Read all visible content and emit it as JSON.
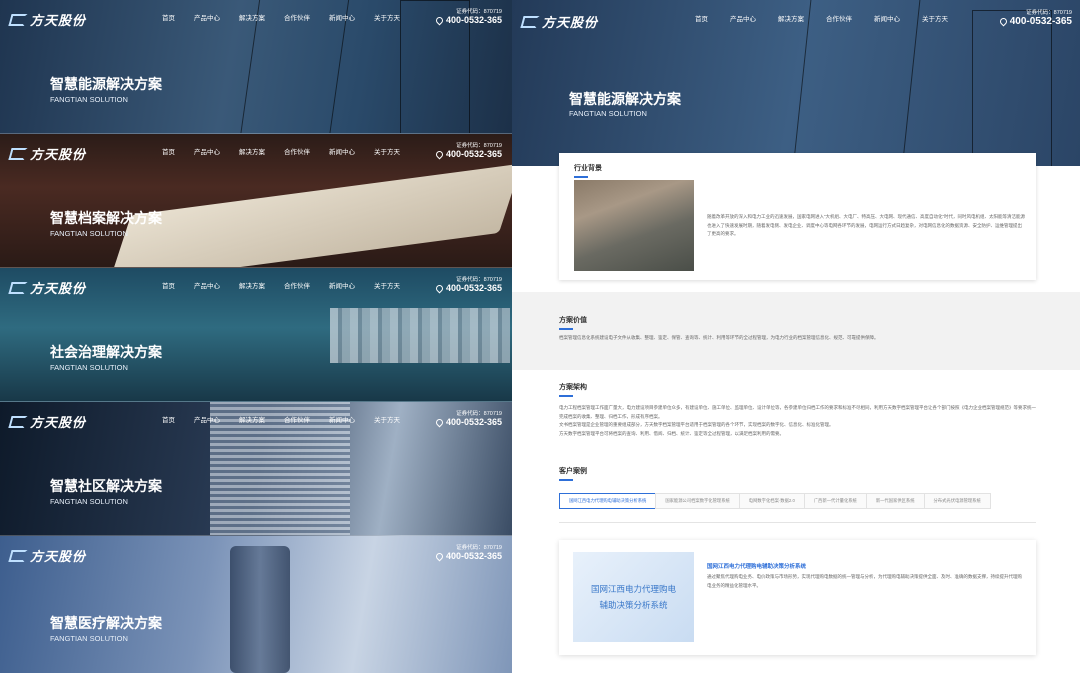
{
  "brand": {
    "logo_text": "方天股份"
  },
  "nav": {
    "items": [
      "首页",
      "产品中心",
      "解决方案",
      "合作伙伴",
      "新闻中心",
      "关于方天"
    ]
  },
  "contact": {
    "code": "证券代码：870719",
    "phone": "400-0532-365"
  },
  "banners": [
    {
      "title": "智慧能源解决方案",
      "subtitle": "FANGTIAN SOLUTION"
    },
    {
      "title": "智慧档案解决方案",
      "subtitle": "FANGTIAN SOLUTION"
    },
    {
      "title": "社会治理解决方案",
      "subtitle": "FANGTIAN SOLUTION"
    },
    {
      "title": "智慧社区解决方案",
      "subtitle": "FANGTIAN SOLUTION"
    },
    {
      "title": "智慧医疗解决方案",
      "subtitle": "FANGTIAN SOLUTION"
    }
  ],
  "detail": {
    "hero_title": "智慧能源解决方案",
    "hero_subtitle": "FANGTIAN SOLUTION",
    "background": {
      "title": "行业背景",
      "text": "随着改革开放的深入和电力工业的迅速发展，国家电网进入“大机组、大电厂、特高压、大电网、现代通信、高度自动化”时代，同时风电机组、太阳能等清洁能源也进入了快速发展时期，随着发电侧、发电企业、调度中心等电网各环节的发展，电网运行方式日趋复杂，对电网信息化的数据资源、安全防护、运维管理提出了更高的要求。"
    },
    "value": {
      "title": "方案价值",
      "text": "档案管理信息化系统建设电子文件从收集、整理、鉴定、保管、查询等、统计、利用等环节的全过程管理，为电力行业的档案管理信息化、规范、可靠提供保障。"
    },
    "architecture": {
      "title": "方案架构",
      "lines": [
        "电力工程档案管理工作面广量大，电力建设项目参建单位众多，有建设单位、施工单位、监理单位、设计单位等，各参建单位归档工作的要求和标准不尽相同，利用方天数字档案管理平台让各个部门按照《电力企业档案管理规范》等要求统一完成档案的收集、整理、归档工作，形成有序档案。",
        "文书档案管理是企业管理的重要组成部分，方天数字档案管理平台适用于档案管理的各个环节，实现档案的数字化、信息化、标准化管理。",
        "方天数字档案管理平台可将档案的查询、利用、借阅、归档、统计、鉴定等全过程管理，以满足档案利用的需要。"
      ]
    },
    "cases": {
      "title": "客户案例",
      "tabs": [
        "国网江西电力代理购电辅助决策分析系统",
        "国家能源公司档案数字化管理系统",
        "电网数字化档案·数据2.0",
        "广西新一代计量化系统",
        "新一代国家供区系统",
        "分布式光伏电源管理系统"
      ],
      "active_card": {
        "image_line1": "国网江西电力代理购电",
        "image_line2": "辅助决策分析系统",
        "title": "国网江西电力代理购电辅助决策分析系统",
        "text": "通过聚焦代理购电业务、电价政策与市场形势，实现代理购电数据的统一管理与分析，为代理购电辅助决策提供全面、及时、准确的数据支撑，持续提升代理购电业务的精益化管理水平。"
      }
    }
  }
}
